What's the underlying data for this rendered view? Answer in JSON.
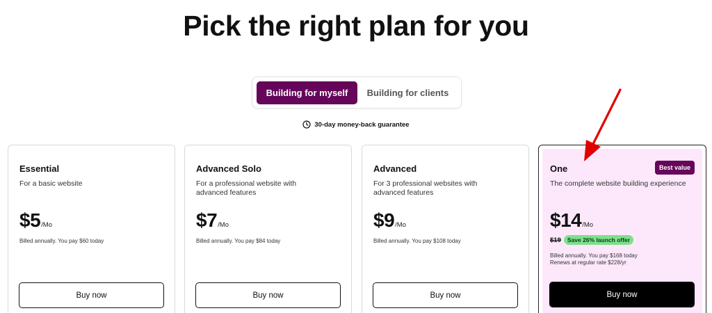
{
  "page": {
    "title": "Pick the right plan for you"
  },
  "toggle": {
    "options": [
      "Building for myself",
      "Building for clients"
    ],
    "selected": "Building for myself"
  },
  "guarantee": {
    "text": "30-day money-back guarantee",
    "icon": "clock-icon"
  },
  "plans": [
    {
      "name": "Essential",
      "description": "For a basic website",
      "price": "$5",
      "unit": "/Mo",
      "billing": [
        "Billed annually. You pay $60 today"
      ],
      "cta": "Buy now"
    },
    {
      "name": "Advanced Solo",
      "description": "For a professional website with advanced features",
      "price": "$7",
      "unit": "/Mo",
      "billing": [
        "Billed annually. You pay $84 today"
      ],
      "cta": "Buy now"
    },
    {
      "name": "Advanced",
      "description": "For 3 professional websites with advanced features",
      "price": "$9",
      "unit": "/Mo",
      "billing": [
        "Billed annually. You pay $108 today"
      ],
      "cta": "Buy now"
    },
    {
      "name": "One",
      "description": "The complete website building experience",
      "price": "$14",
      "unit": "/Mo",
      "badge": "Best value",
      "old_price": "$19",
      "promo": "Save 26% launch offer",
      "billing": [
        "Billed annually. You pay $168 today",
        "Renews at regular rate $228/yr"
      ],
      "cta": "Buy now"
    }
  ],
  "colors": {
    "brand": "#65065a",
    "featured_bg": "#fde8fb",
    "promo_green": "#7ee08d",
    "annotation_arrow": "#e00000"
  }
}
